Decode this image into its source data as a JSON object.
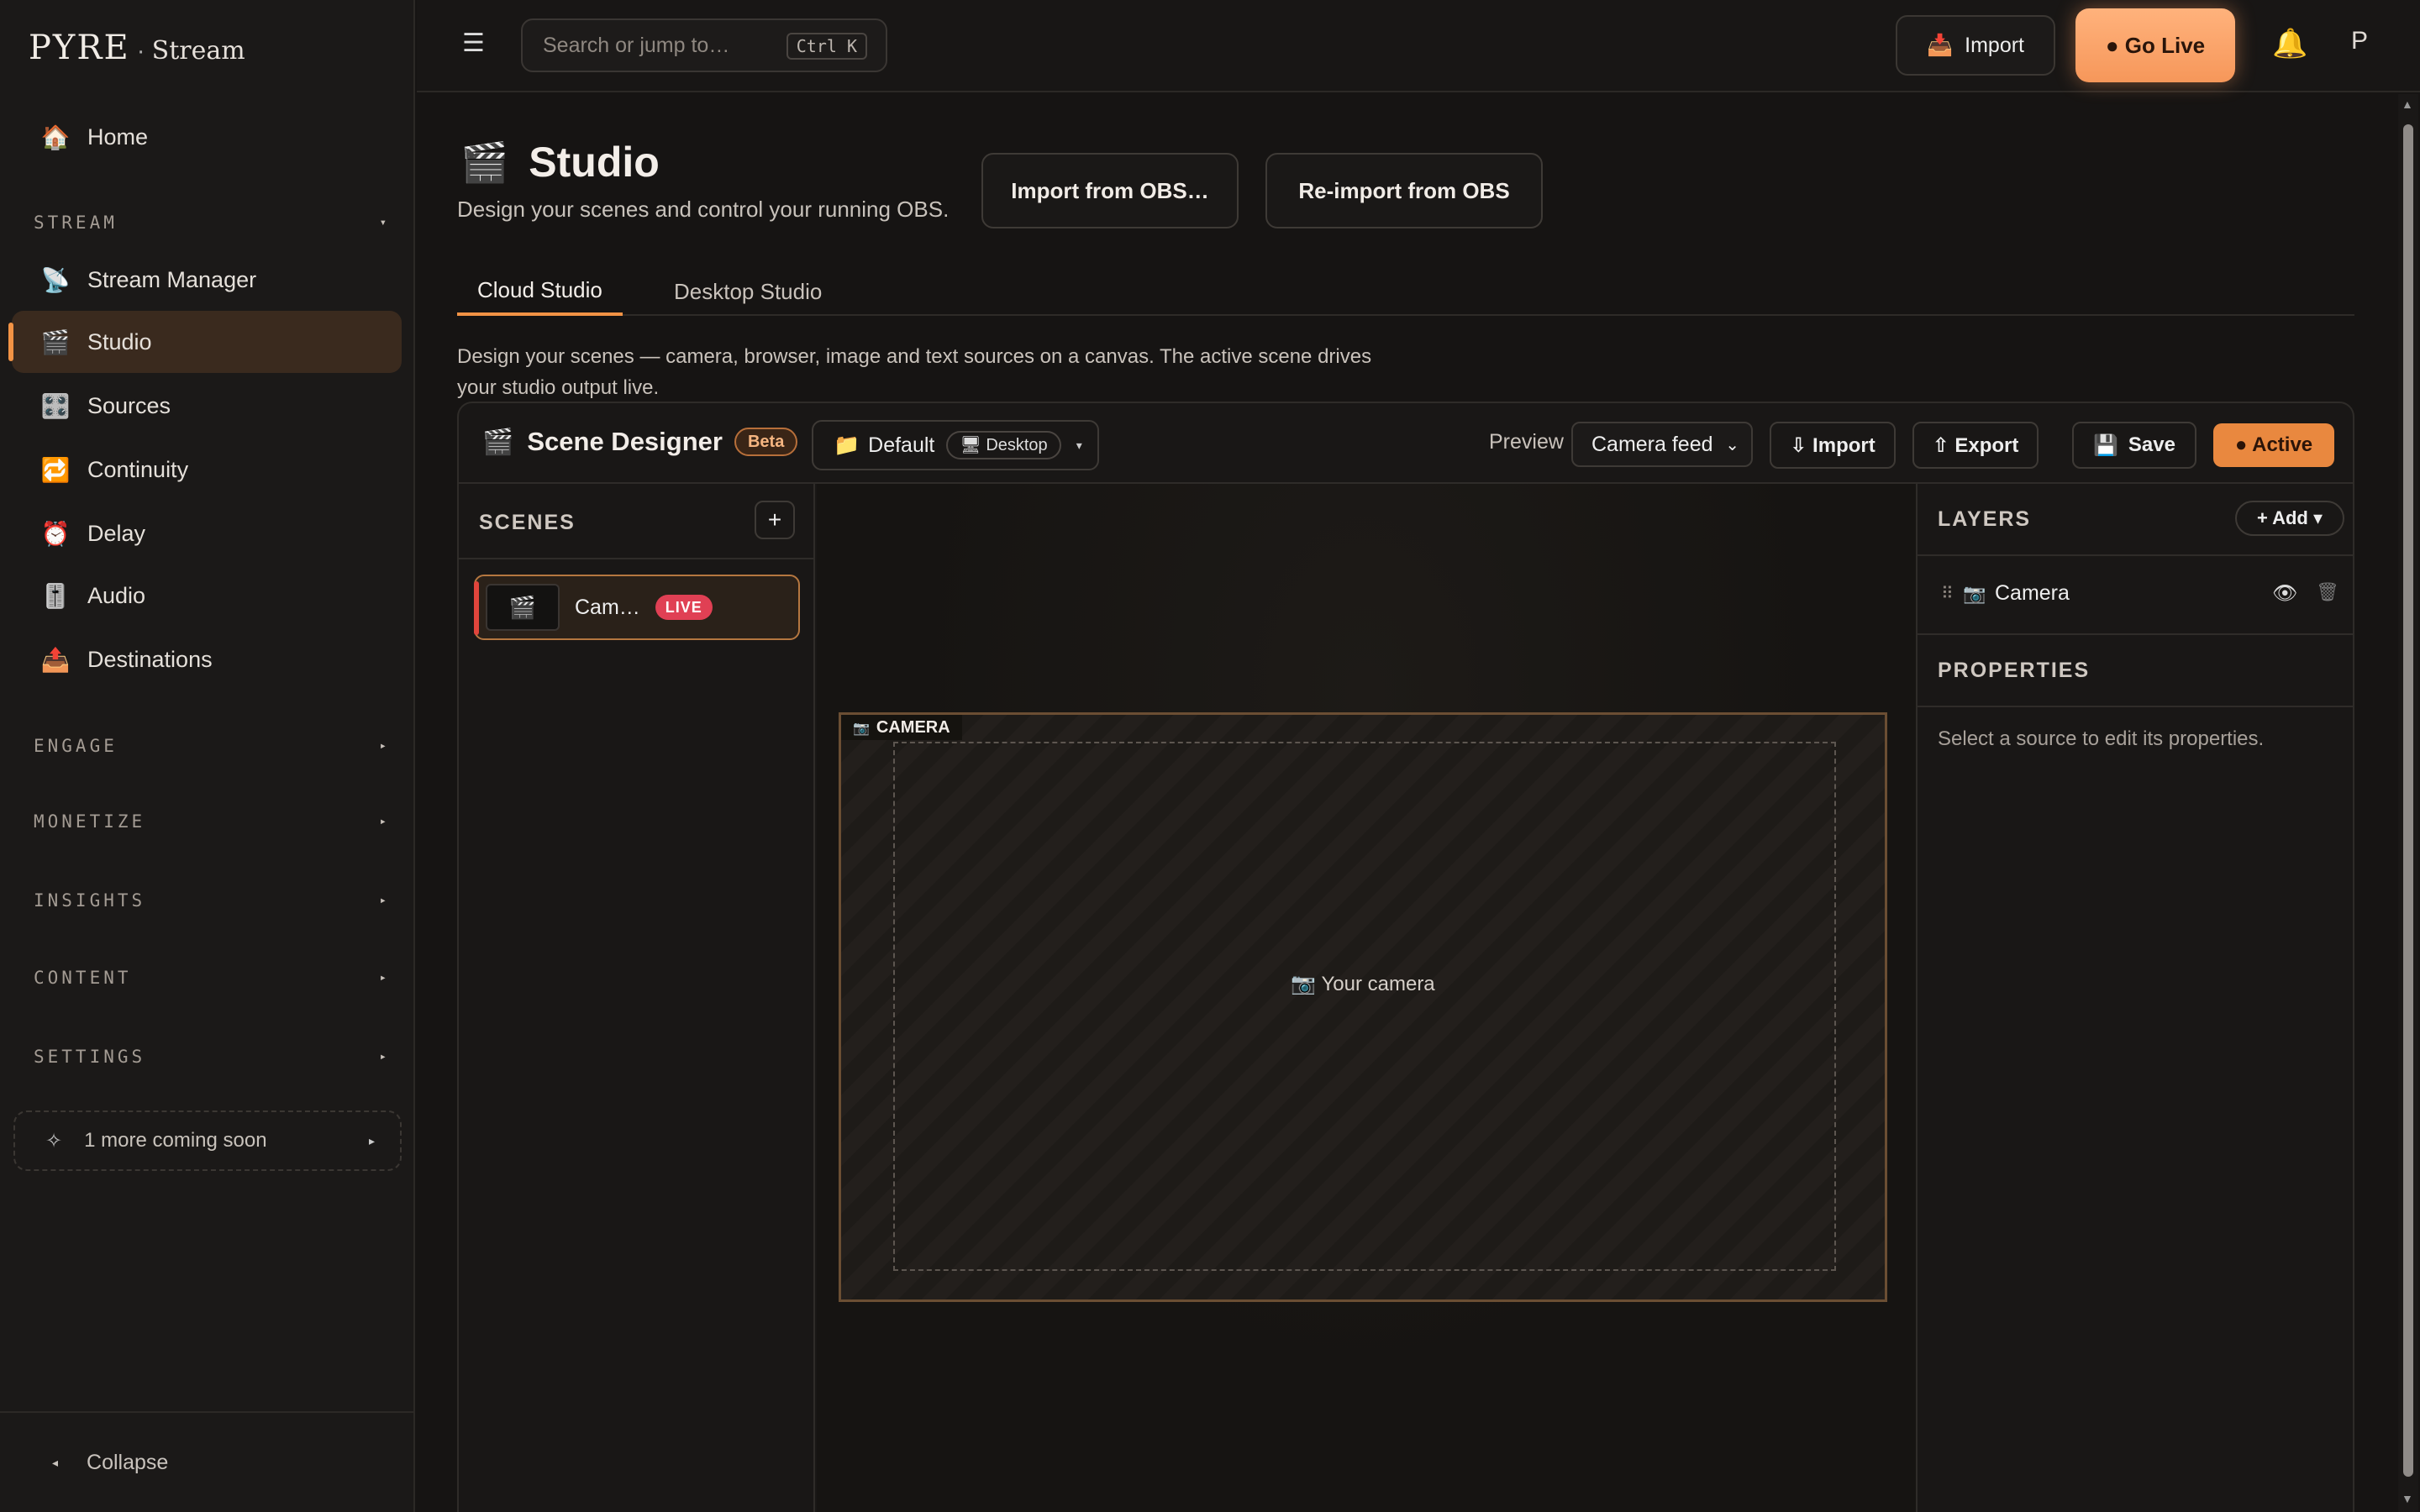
{
  "brand": {
    "logo": "PYRE",
    "separator": "·",
    "product": "Stream"
  },
  "sidebar": {
    "home": {
      "icon": "🏠",
      "label": "Home"
    },
    "sections": {
      "stream": "STREAM",
      "engage": "ENGAGE",
      "monetize": "MONETIZE",
      "insights": "INSIGHTS",
      "content": "CONTENT",
      "settings": "SETTINGS"
    },
    "items": [
      {
        "icon": "📡",
        "label": "Stream Manager"
      },
      {
        "icon": "🎬",
        "label": "Studio"
      },
      {
        "icon": "🎛️",
        "label": "Sources"
      },
      {
        "icon": "🔁",
        "label": "Continuity"
      },
      {
        "icon": "⏰",
        "label": "Delay"
      },
      {
        "icon": "🎚️",
        "label": "Audio"
      },
      {
        "icon": "📤",
        "label": "Destinations"
      }
    ],
    "coming_soon": {
      "icon": "✧",
      "label": "1 more coming soon"
    },
    "collapse_label": "Collapse"
  },
  "topbar": {
    "search_placeholder": "Search or jump to…",
    "search_shortcut": "Ctrl K",
    "import_icon": "📥",
    "import_label": "Import",
    "golive_label": "● Go Live",
    "avatar_initial": "P"
  },
  "page": {
    "icon": "🎬",
    "title": "Studio",
    "subtitle": "Design your scenes and control your running OBS.",
    "import_obs": "Import from OBS…",
    "reimport_obs": "Re-import from OBS",
    "tabs": [
      "Cloud Studio",
      "Desktop Studio"
    ],
    "tab_description": "Design your scenes — camera, browser, image and text sources on a canvas. The active scene drives your studio output live."
  },
  "designer": {
    "icon": "🎬",
    "title": "Scene Designer",
    "badge": "Beta",
    "collection_icon": "📁",
    "collection": "Default",
    "target_icon": "🖥",
    "target": "Desktop",
    "preview_label": "Preview",
    "preview_value": "Camera feed",
    "import_label": "⇩ Import",
    "export_label": "⇧ Export",
    "save_icon": "💾",
    "save_label": "Save",
    "active_label": "● Active"
  },
  "scenes": {
    "title": "SCENES",
    "add": "+",
    "items": [
      {
        "icon": "🎬",
        "name": "Cam…",
        "badge": "LIVE"
      }
    ]
  },
  "canvas": {
    "source_icon": "📷",
    "source_label": "CAMERA",
    "placeholder": "Your camera"
  },
  "layers": {
    "title": "LAYERS",
    "add_label": "+ Add ▾",
    "items": [
      {
        "icon": "📷",
        "name": "Camera"
      }
    ]
  },
  "properties": {
    "title": "PROPERTIES",
    "hint": "Select a source to edit its properties."
  },
  "colors": {
    "accent": "#f29345",
    "live": "#e04054",
    "background": "#161413"
  }
}
